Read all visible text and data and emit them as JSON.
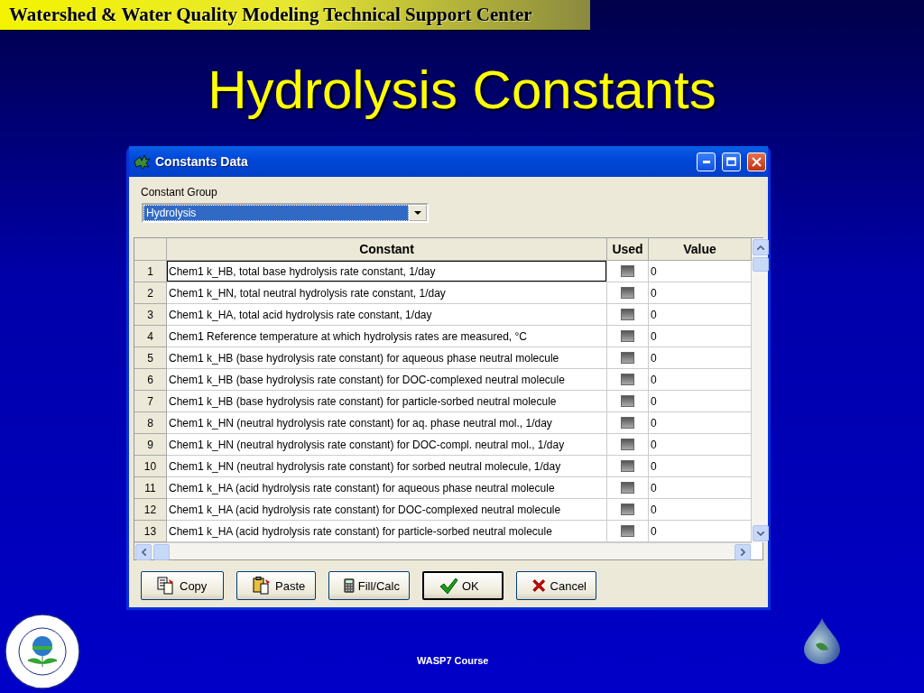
{
  "slide": {
    "header": "Watershed & Water Quality Modeling Technical Support Center",
    "title": "Hydrolysis Constants",
    "footer": "WASP7 Course"
  },
  "window": {
    "title": "Constants Data",
    "group_label": "Constant Group",
    "group_value": "Hydrolysis",
    "columns": [
      "Constant",
      "Used",
      "Value"
    ],
    "rows": [
      {
        "number": "1",
        "constant": "Chem1 k_HB, total base hydrolysis rate constant, 1/day",
        "used": false,
        "value": "0",
        "selected": true
      },
      {
        "number": "2",
        "constant": "Chem1 k_HN, total neutral hydrolysis rate constant, 1/day",
        "used": false,
        "value": "0",
        "selected": false
      },
      {
        "number": "3",
        "constant": "Chem1 k_HA, total acid hydrolysis rate constant, 1/day",
        "used": false,
        "value": "0",
        "selected": false
      },
      {
        "number": "4",
        "constant": "Chem1 Reference temperature at which hydrolysis rates are measured, °C",
        "used": false,
        "value": "0",
        "selected": false
      },
      {
        "number": "5",
        "constant": "Chem1 k_HB (base hydrolysis rate constant) for aqueous phase neutral molecule",
        "used": false,
        "value": "0",
        "selected": false
      },
      {
        "number": "6",
        "constant": "Chem1 k_HB (base hydrolysis rate constant) for DOC-complexed neutral molecule",
        "used": false,
        "value": "0",
        "selected": false
      },
      {
        "number": "7",
        "constant": "Chem1 k_HB (base hydrolysis rate constant) for particle-sorbed neutral molecule",
        "used": false,
        "value": "0",
        "selected": false
      },
      {
        "number": "8",
        "constant": "Chem1 k_HN (neutral hydrolysis rate constant) for aq. phase neutral mol., 1/day",
        "used": false,
        "value": "0",
        "selected": false
      },
      {
        "number": "9",
        "constant": "Chem1 k_HN (neutral hydrolysis rate constant) for DOC-compl. neutral mol., 1/day",
        "used": false,
        "value": "0",
        "selected": false
      },
      {
        "number": "10",
        "constant": "Chem1 k_HN (neutral hydrolysis rate constant) for sorbed neutral molecule, 1/day",
        "used": false,
        "value": "0",
        "selected": false
      },
      {
        "number": "11",
        "constant": "Chem1 k_HA (acid hydrolysis rate constant) for aqueous phase neutral molecule",
        "used": false,
        "value": "0",
        "selected": false
      },
      {
        "number": "12",
        "constant": "Chem1 k_HA (acid hydrolysis rate constant) for DOC-complexed neutral molecule",
        "used": false,
        "value": "0",
        "selected": false
      },
      {
        "number": "13",
        "constant": "Chem1 k_HA (acid hydrolysis rate constant) for particle-sorbed neutral molecule",
        "used": false,
        "value": "0",
        "selected": false
      }
    ],
    "buttons": [
      {
        "kind": "copy",
        "label": "Copy",
        "default": false
      },
      {
        "kind": "paste",
        "label": "Paste",
        "default": false
      },
      {
        "kind": "calc",
        "label": "Fill/Calc",
        "default": false
      },
      {
        "kind": "ok",
        "label": "OK",
        "default": true
      },
      {
        "kind": "cancel",
        "label": "Cancel",
        "default": false
      }
    ]
  }
}
